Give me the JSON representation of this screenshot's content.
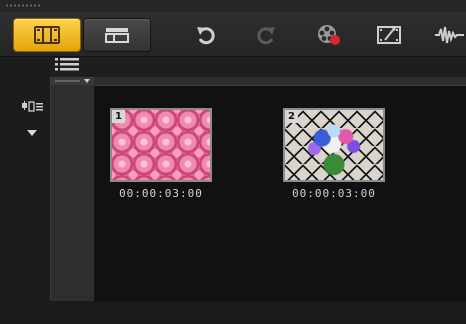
{
  "toolbar": {
    "modes": [
      {
        "name": "storyboard-view",
        "icon": "filmstrip-icon",
        "active": true
      },
      {
        "name": "timeline-view",
        "icon": "timeline-icon",
        "active": false
      }
    ],
    "tools": [
      {
        "name": "undo",
        "icon": "undo-icon",
        "enabled": true
      },
      {
        "name": "redo",
        "icon": "redo-icon",
        "enabled": false
      },
      {
        "name": "record-capture",
        "icon": "record-capture-icon"
      },
      {
        "name": "instant-project",
        "icon": "film-edit-icon"
      },
      {
        "name": "audio-mixer",
        "icon": "audio-waveform-icon"
      }
    ]
  },
  "storyboard": {
    "clips": [
      {
        "number": "1",
        "timecode": "00:00:03:00",
        "thumbnail": "pink-roses"
      },
      {
        "number": "2",
        "timecode": "00:00:03:00",
        "thumbnail": "flower-bouquet"
      }
    ]
  },
  "colors": {
    "accent": "#f0b420",
    "background": "#111111",
    "panel": "#2f2f2f"
  }
}
